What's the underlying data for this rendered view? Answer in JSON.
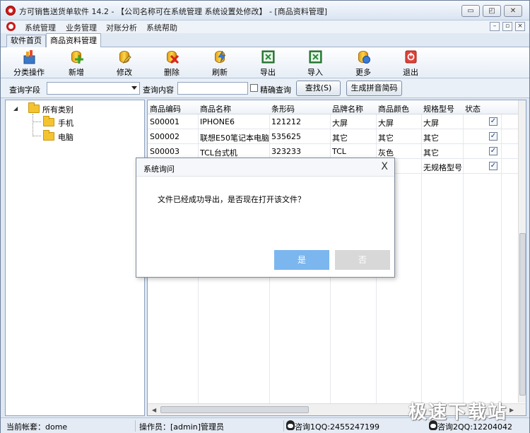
{
  "window": {
    "title": "方可销售送货单软件 14.2 - 【公司名称可在系统管理 系统设置处修改】 - [商品资料管理]",
    "controls": [
      "▭",
      "◰",
      "✕"
    ]
  },
  "menu": {
    "items": [
      "系统管理",
      "业务管理",
      "对账分析",
      "系统帮助"
    ],
    "mdi_controls": [
      "–",
      "▫",
      "×"
    ]
  },
  "tabs": [
    "软件首页",
    "商品资料管理"
  ],
  "toolbar": [
    {
      "label": "分类操作",
      "icon": "category-icon"
    },
    {
      "label": "新增",
      "icon": "add-icon"
    },
    {
      "label": "修改",
      "icon": "edit-icon"
    },
    {
      "label": "删除",
      "icon": "delete-icon"
    },
    {
      "label": "刷新",
      "icon": "refresh-icon"
    },
    {
      "label": "导出",
      "icon": "export-excel-icon"
    },
    {
      "label": "导入",
      "icon": "import-excel-icon"
    },
    {
      "label": "更多",
      "icon": "more-icon"
    },
    {
      "label": "退出",
      "icon": "exit-icon"
    }
  ],
  "query": {
    "field_label": "查询字段",
    "field_value": "",
    "content_label": "查询内容",
    "content_value": "",
    "exact_label": "精确查询",
    "exact_checked": false,
    "search_button": "查找(S)",
    "pinyin_button": "生成拼音简码"
  },
  "tree": {
    "root": "所有类别",
    "children": [
      "手机",
      "电脑"
    ]
  },
  "grid": {
    "columns": [
      "商品编码",
      "商品名称",
      "条形码",
      "品牌名称",
      "商品颜色",
      "规格型号",
      "状态"
    ],
    "rows": [
      [
        "S00001",
        "IPHONE6",
        "121212",
        "大屏",
        "大屏",
        "大屏",
        true
      ],
      [
        "S00002",
        "联想E50笔记本电脑",
        "535625",
        "其它",
        "其它",
        "其它",
        true
      ],
      [
        "S00003",
        "TCL台式机",
        "323233",
        "TCL",
        "灰色",
        "其它",
        true
      ],
      [
        "",
        "",
        "",
        "",
        "",
        "无规格型号",
        true
      ]
    ]
  },
  "status": {
    "account": "当前帐套：dome",
    "operator": "操作员：[admin]管理员",
    "qq1": "咨询1QQ:2455247199",
    "qq2": "咨询2QQ:12204042"
  },
  "dialog": {
    "title": "系统询问",
    "message": "文件已经成功导出，是否现在打开该文件？",
    "yes": "是",
    "no": "否",
    "close": "X"
  },
  "watermark": "极速下载站",
  "colors": {
    "dialog_yes": "#7bb6ef",
    "dialog_no": "#d8d8d8",
    "folder": "#f4c430",
    "app_icon": "#d11c1c"
  }
}
